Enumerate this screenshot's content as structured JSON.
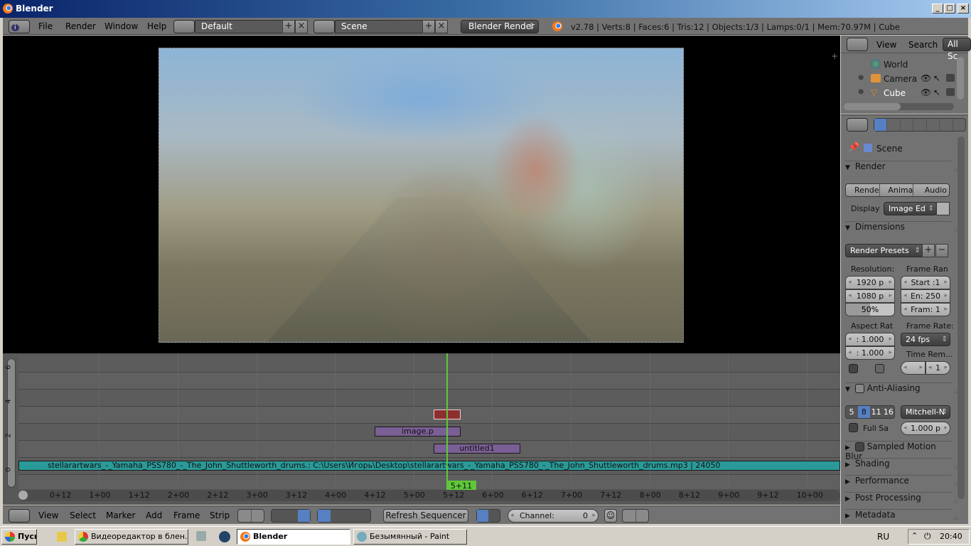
{
  "window": {
    "title": "Blender",
    "controls": [
      "minimize",
      "maximize",
      "close"
    ]
  },
  "info_header": {
    "menus": [
      "File",
      "Render",
      "Window",
      "Help"
    ],
    "screen_layout": "Default",
    "scene": "Scene",
    "render_engine": "Blender Render",
    "stats": "v2.78 | Verts:8 | Faces:6 | Tris:12 | Objects:1/3 | Lamps:0/1 | Mem:70.97M | Cube"
  },
  "outliner": {
    "header": {
      "view": "View",
      "search": "Search",
      "filter": "All Sc"
    },
    "items": [
      {
        "name": "World",
        "icon": "world-icon"
      },
      {
        "name": "Camera",
        "icon": "camera-object-icon"
      },
      {
        "name": "Cube",
        "icon": "mesh-object-icon"
      }
    ]
  },
  "properties": {
    "tabs": [
      "render",
      "render-layers",
      "scene",
      "world",
      "object",
      "constraints",
      "modifiers"
    ],
    "context": "Scene",
    "render": {
      "title": "Render",
      "buttons": [
        "Rende",
        "Anima",
        "Audio"
      ],
      "display_label": "Display",
      "display_value": "Image Ed"
    },
    "dimensions": {
      "title": "Dimensions",
      "presets": "Render Presets",
      "resolution_label": "Resolution:",
      "res_x": "1920 p",
      "res_y": "1080 p",
      "res_pct": "50%",
      "res_pct_value": 0.5,
      "frame_range_label": "Frame Ran",
      "start": "Start :1",
      "end": "En: 250",
      "frame_step": "Fram: 1",
      "aspect_label": "Aspect Rat",
      "aspect_x": ": 1.000",
      "aspect_y": ": 1.000",
      "frame_rate_label": "Frame Rate:",
      "frame_rate": "24 fps",
      "time_remap_label": "Time Rem...",
      "time_old": "",
      "time_new": "1"
    },
    "anti_aliasing": {
      "title": "Anti-Aliasing",
      "enabled": true,
      "samples": [
        "5",
        "8",
        "11",
        "16"
      ],
      "selected": "8",
      "filter": "Mitchell-N",
      "full_sample": "Full Sa",
      "size": "1.000 p"
    },
    "collapsed_panels": [
      "Sampled Motion Blur",
      "Shading",
      "Performance",
      "Post Processing",
      "Metadata"
    ]
  },
  "sequencer": {
    "channel_labels": [
      "6",
      "4",
      "2",
      "0"
    ],
    "time_ticks": [
      "0+12",
      "1+00",
      "1+12",
      "2+00",
      "2+12",
      "3+00",
      "3+12",
      "4+00",
      "4+12",
      "5+00",
      "5+12",
      "6+00",
      "6+12",
      "7+00",
      "7+12",
      "8+00",
      "8+12",
      "9+00",
      "9+12",
      "10+00"
    ],
    "current_frame": "5+11",
    "strips": [
      {
        "name": "",
        "type": "color",
        "channel": 4,
        "color": "#8c2f2f"
      },
      {
        "name": "image.p",
        "type": "image",
        "channel": 3,
        "color": "#7a5f94"
      },
      {
        "name": "untitled1",
        "type": "image",
        "channel": 2,
        "color": "#7a5f94"
      },
      {
        "name": "stellarartwars_-_Yamaha_PSS780_-_The_John_Shuttleworth_drums.: C:\\Users\\Игорь\\Desktop\\stellarartwars_-_Yamaha_PSS780_-_The_John_Shuttleworth_drums.mp3 | 24050",
        "type": "sound",
        "channel": 1,
        "color": "#2a9a98"
      }
    ]
  },
  "sequencer_header": {
    "menus": [
      "View",
      "Select",
      "Marker",
      "Add",
      "Frame",
      "Strip"
    ],
    "refresh_button": "Refresh Sequencer",
    "channel_field": {
      "label": "Channel:",
      "value": "0"
    }
  },
  "taskbar": {
    "start": "Пуск",
    "items": [
      {
        "label": "Видеоредактор в блен...",
        "active": false
      },
      {
        "label": "Blender",
        "active": true
      },
      {
        "label": "Безымянный - Paint",
        "active": false
      }
    ],
    "language": "RU",
    "clock": "20:40"
  }
}
